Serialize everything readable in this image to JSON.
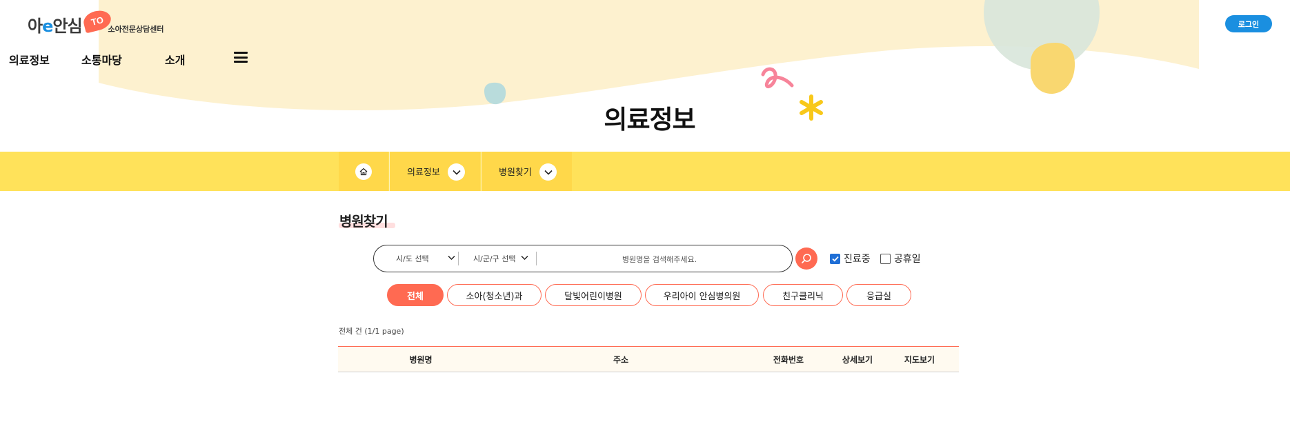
{
  "header": {
    "logo": {
      "main_a": "아",
      "main_e": "e",
      "main_b": "안심",
      "badge": "TO",
      "sub": "소아전문상담센터"
    },
    "nav": [
      "의료정보",
      "소통마당",
      "소개"
    ],
    "login_label": "로그인",
    "page_title": "의료정보"
  },
  "breadcrumb": {
    "items": [
      "의료정보",
      "병원찾기"
    ]
  },
  "section": {
    "title": "병원찾기"
  },
  "search": {
    "sido_label": "시/도 선택",
    "sigungu_label": "시/군/구 선택",
    "placeholder": "병원명을 검색해주세요.",
    "checkboxes": [
      {
        "label": "진료중",
        "checked": true
      },
      {
        "label": "공휴일",
        "checked": false
      }
    ]
  },
  "tabs": [
    "전체",
    "소아(청소년)과",
    "달빛어린이병원",
    "우리아이 안심병의원",
    "친구클리닉",
    "응급실"
  ],
  "active_tab": "전체",
  "result": {
    "count_text": "전체 건 (1/1 page)"
  },
  "table": {
    "columns": [
      "병원명",
      "주소",
      "전화번호",
      "상세보기",
      "지도보기"
    ]
  },
  "colors": {
    "accent": "#ff6a52",
    "yellow_bar": "#ffe25a",
    "blue": "#1a8fe0",
    "cream": "#fdf1cf"
  },
  "icons": [
    "menu-icon",
    "home-icon",
    "chevron-down-icon",
    "search-icon",
    "check-icon"
  ]
}
